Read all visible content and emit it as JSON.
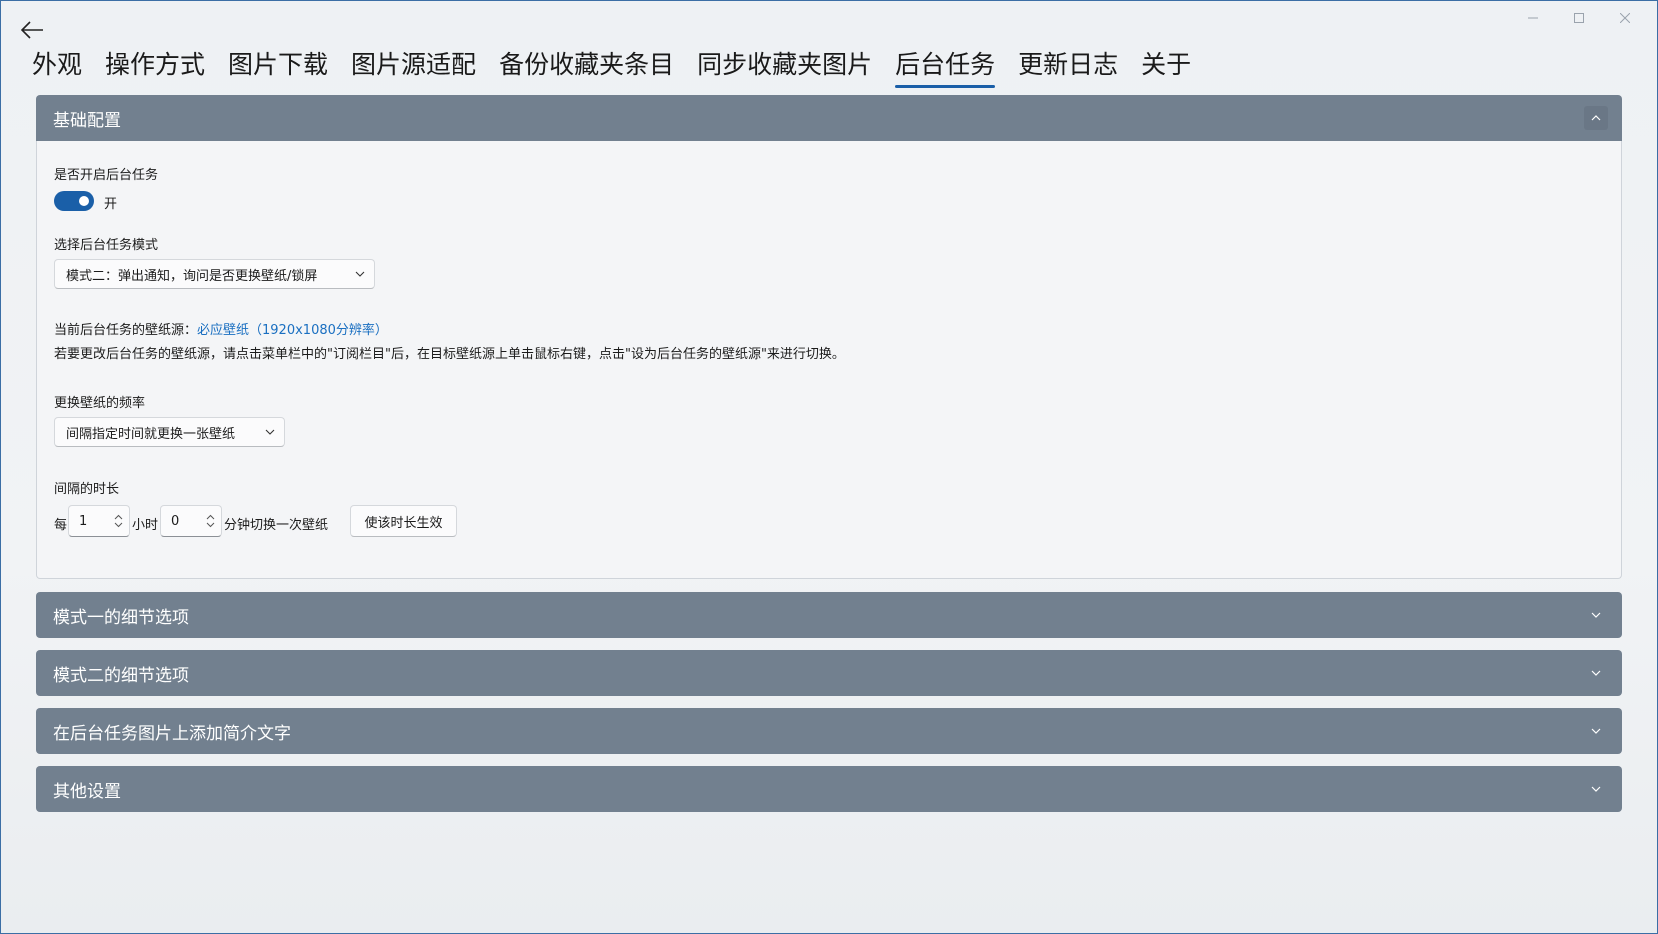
{
  "nav": {
    "tabs": [
      {
        "label": "外观"
      },
      {
        "label": "操作方式"
      },
      {
        "label": "图片下载"
      },
      {
        "label": "图片源适配"
      },
      {
        "label": "备份收藏夹条目"
      },
      {
        "label": "同步收藏夹图片"
      },
      {
        "label": "后台任务",
        "active": true
      },
      {
        "label": "更新日志"
      },
      {
        "label": "关于"
      }
    ]
  },
  "basic": {
    "header": "基础配置",
    "enable_label": "是否开启后台任务",
    "toggle_state": "开",
    "mode_label": "选择后台任务模式",
    "mode_value": "模式二：弹出通知，询问是否更换壁纸/锁屏",
    "source_prefix": "当前后台任务的壁纸源：",
    "source_link": "必应壁纸（1920x1080分辨率）",
    "source_hint": "若要更改后台任务的壁纸源，请点击菜单栏中的\"订阅栏目\"后，在目标壁纸源上单击鼠标右键，点击\"设为后台任务的壁纸源\"来进行切换。",
    "freq_label": "更换壁纸的频率",
    "freq_value": "间隔指定时间就更换一张壁纸",
    "interval_label": "间隔的时长",
    "every": "每",
    "hours_value": "1",
    "hours_unit": "小时",
    "minutes_value": "0",
    "minutes_unit": "分钟切换一次壁纸",
    "apply_button": "使该时长生效"
  },
  "sections": [
    {
      "header": "模式一的细节选项"
    },
    {
      "header": "模式二的细节选项"
    },
    {
      "header": "在后台任务图片上添加简介文字"
    },
    {
      "header": "其他设置"
    }
  ],
  "colors": {
    "accent": "#1a5fa8",
    "header_bg": "#72808f",
    "link": "#1a6fc1"
  }
}
